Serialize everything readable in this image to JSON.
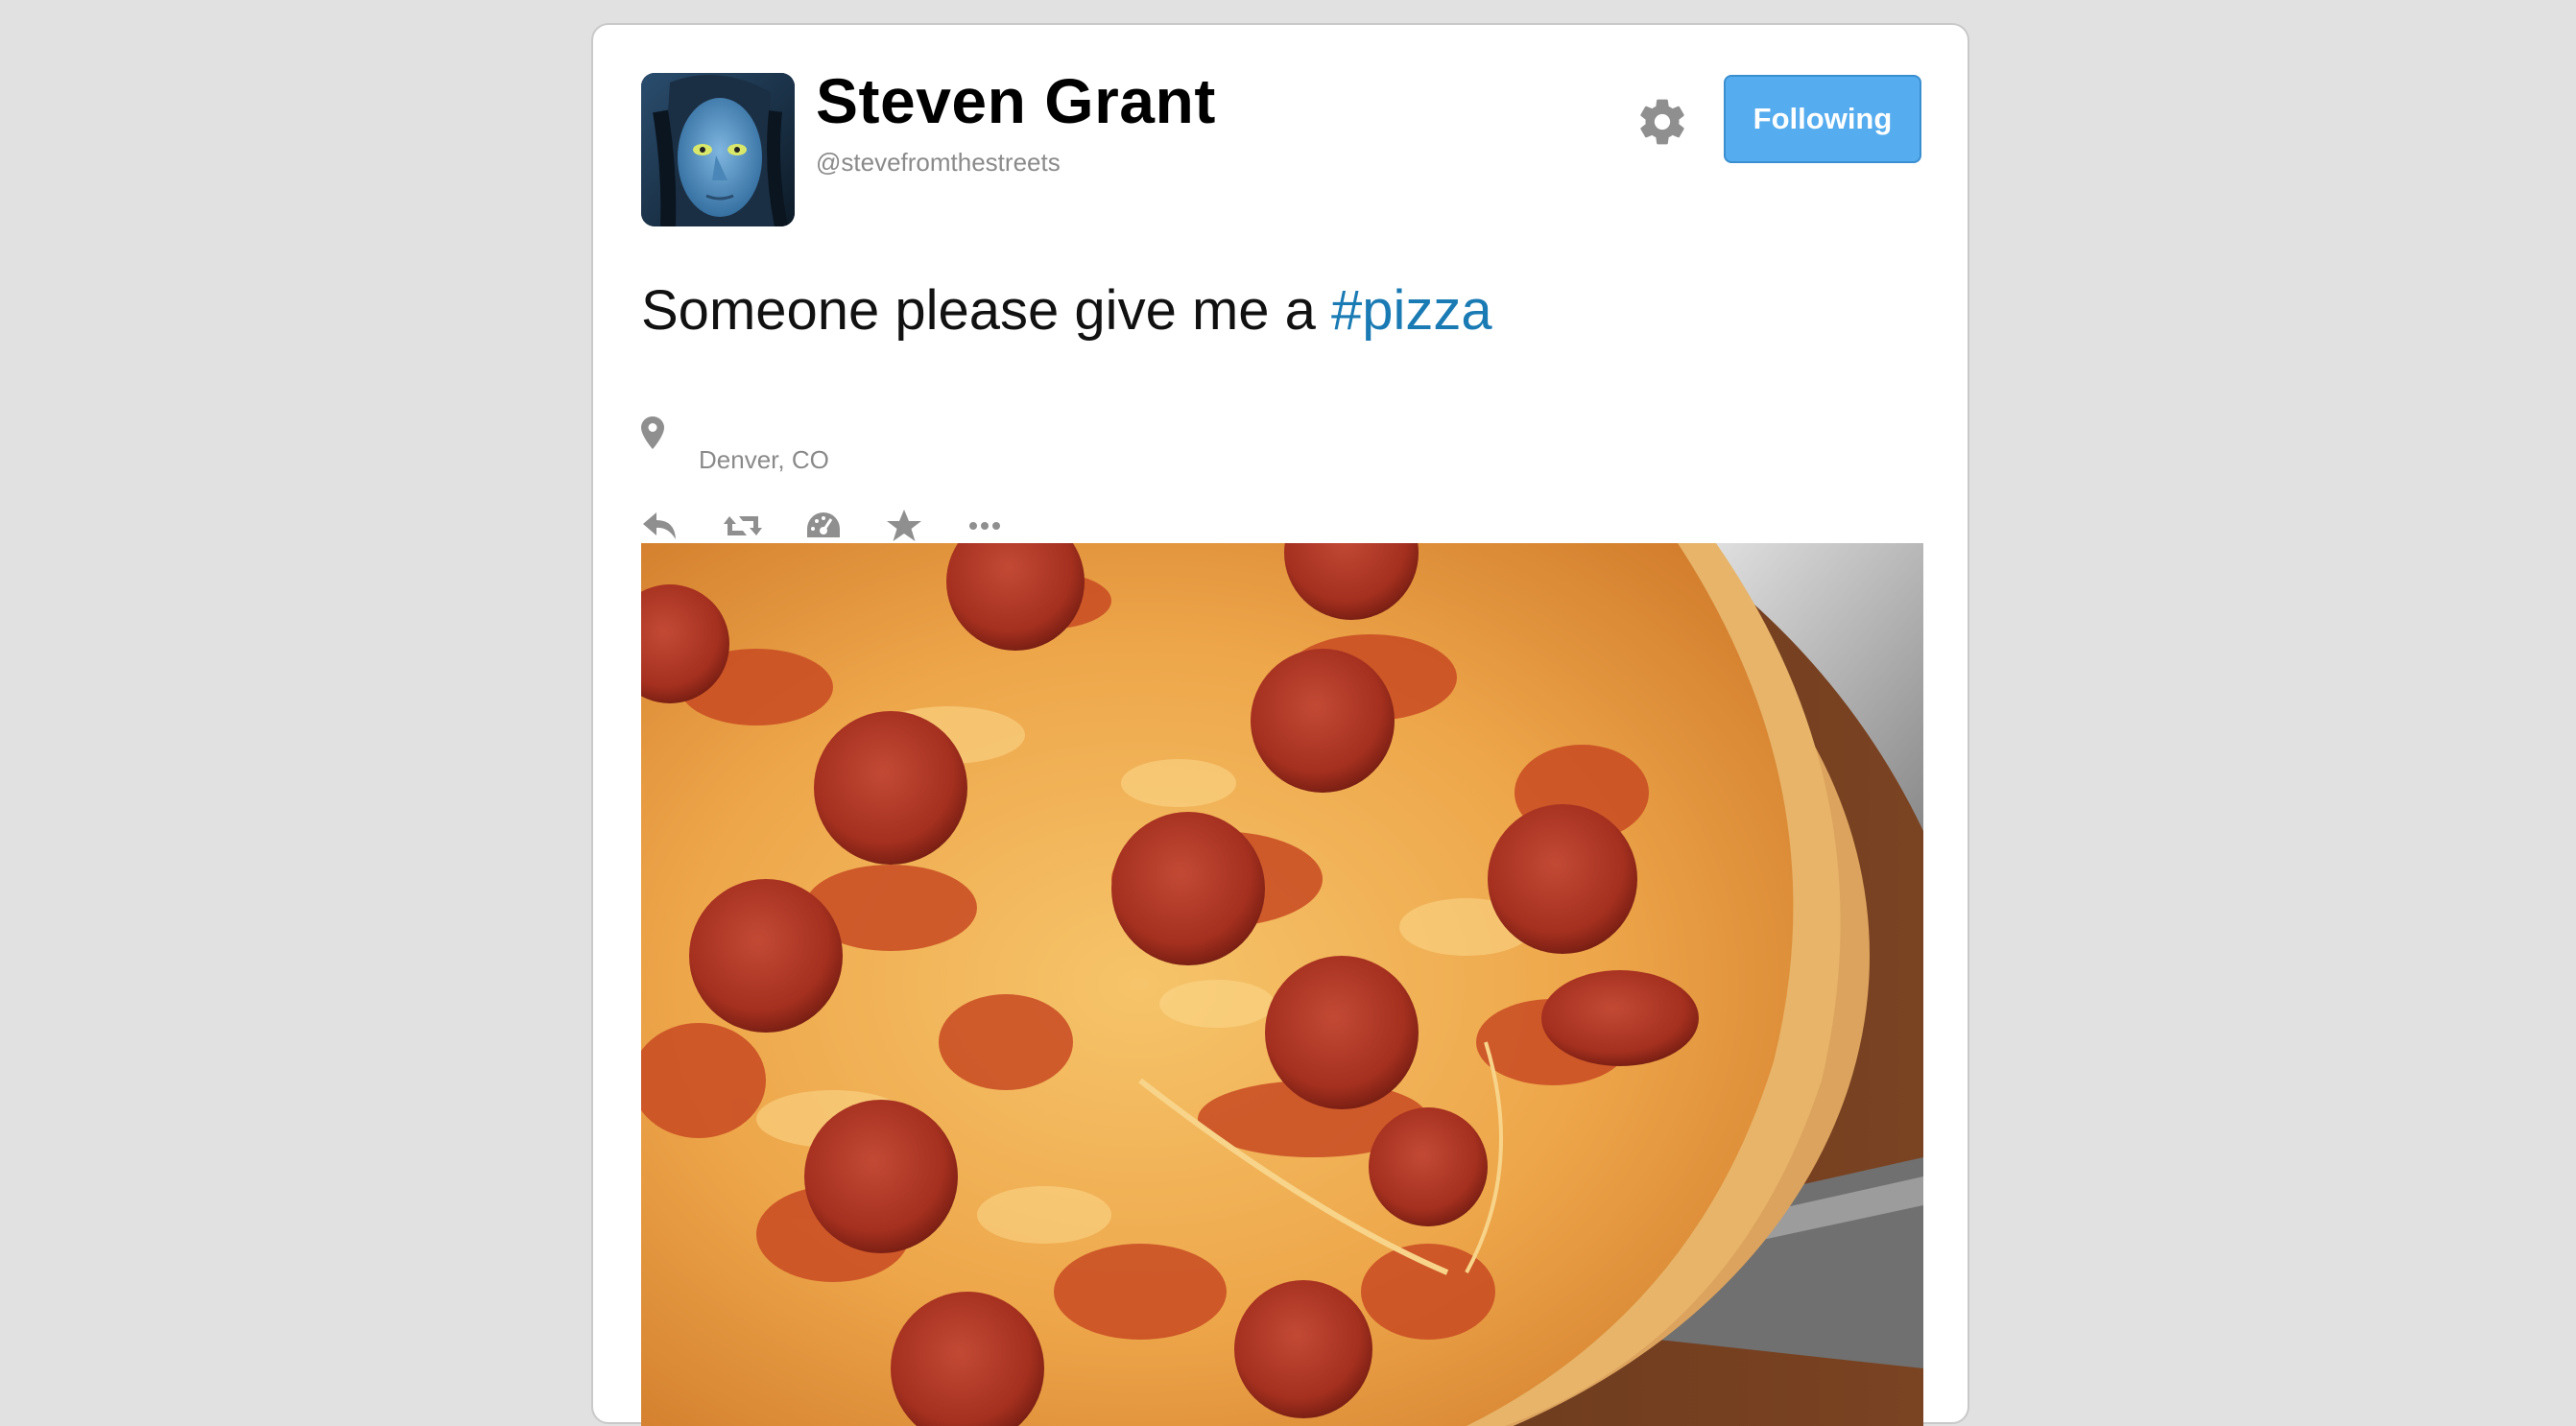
{
  "tweet": {
    "author": {
      "name": "Steven Grant",
      "handle": "@stevefromthestreets"
    },
    "follow_button_label": "Following",
    "text_prefix": "Someone please give me a ",
    "hashtag": "#pizza",
    "location": "Denver, CO",
    "actions": [
      "reply",
      "retweet",
      "stats",
      "favorite",
      "more"
    ]
  },
  "colors": {
    "page_background": "#e1e1e1",
    "follow_button": "#55acee",
    "hashtag": "#1a7bb4",
    "muted_text": "#8a8a8a"
  },
  "icons": {
    "settings": "gear-icon",
    "location": "location-pin-icon",
    "reply": "reply-icon",
    "retweet": "retweet-icon",
    "stats": "dashboard-icon",
    "favorite": "star-icon",
    "more": "more-dots-icon"
  }
}
